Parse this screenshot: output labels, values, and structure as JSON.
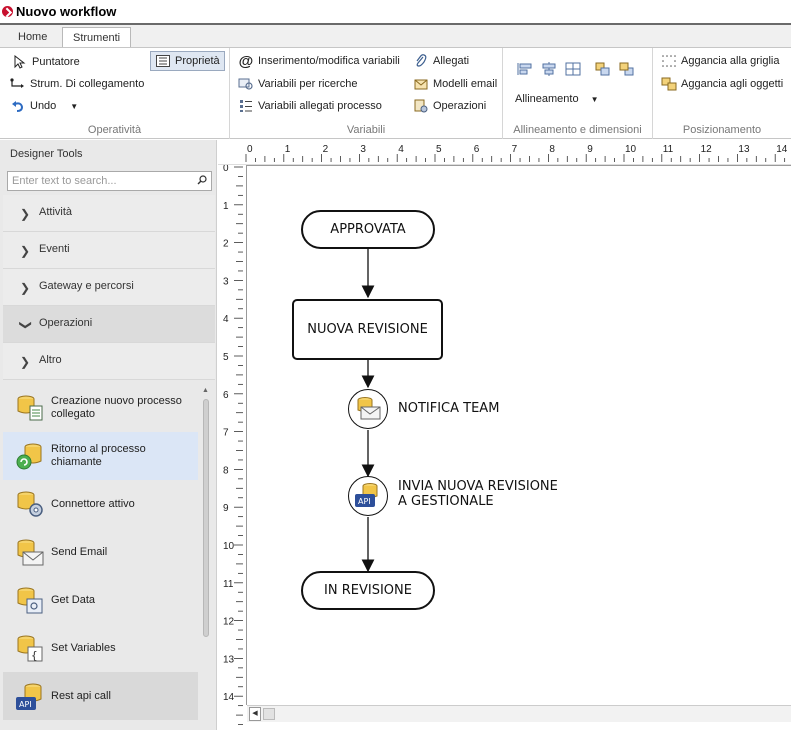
{
  "window": {
    "title": "Nuovo workflow"
  },
  "tabs": [
    {
      "label": "Home"
    },
    {
      "label": "Strumenti"
    }
  ],
  "ribbon": {
    "operativita": {
      "title": "Operatività",
      "puntatore": "Puntatore",
      "strum_collegamento": "Strum. Di collegamento",
      "undo": "Undo",
      "proprieta": "Proprietà"
    },
    "variabili": {
      "title": "Variabili",
      "inserimento": "Inserimento/modifica variabili",
      "ricerche": "Variabili per ricerche",
      "allegati_processo": "Variabili allegati processo",
      "allegati": "Allegati",
      "modelli_email": "Modelli email",
      "operazioni": "Operazioni"
    },
    "allineamento": {
      "title": "Allineamento e dimensioni",
      "allineamento_label": "Allineamento"
    },
    "posizionamento": {
      "title": "Posizionamento",
      "aggancia_griglia": "Aggancia alla griglia",
      "aggancia_oggetti": "Aggancia agli oggetti"
    }
  },
  "sidebar": {
    "title": "Designer Tools",
    "search_placeholder": "Enter text to search...",
    "categories": [
      {
        "label": "Attività"
      },
      {
        "label": "Eventi"
      },
      {
        "label": "Gateway e percorsi"
      },
      {
        "label": "Operazioni"
      },
      {
        "label": "Altro"
      }
    ],
    "tools": [
      {
        "label": "Creazione nuovo processo collegato"
      },
      {
        "label": "Ritorno al processo chiamante"
      },
      {
        "label": "Connettore attivo"
      },
      {
        "label": "Send Email"
      },
      {
        "label": "Get Data"
      },
      {
        "label": "Set Variables"
      },
      {
        "label": "Rest api call"
      }
    ]
  },
  "ruler": {
    "h": [
      "0",
      "1",
      "2",
      "3",
      "4",
      "5",
      "6",
      "7",
      "8",
      "9",
      "10",
      "11",
      "12",
      "13",
      "14"
    ],
    "v": [
      "0",
      "1",
      "2",
      "3",
      "4",
      "5",
      "6",
      "7",
      "8",
      "9",
      "10",
      "11",
      "12",
      "13",
      "14"
    ]
  },
  "workflow": {
    "start": "APPROVATA",
    "step1": "NUOVA REVISIONE",
    "notify": "NOTIFICA TEAM",
    "invia_line1": "INVIA NUOVA REVISIONE",
    "invia_line2": "A GESTIONALE",
    "end": "IN REVISIONE",
    "api_badge": "API"
  }
}
